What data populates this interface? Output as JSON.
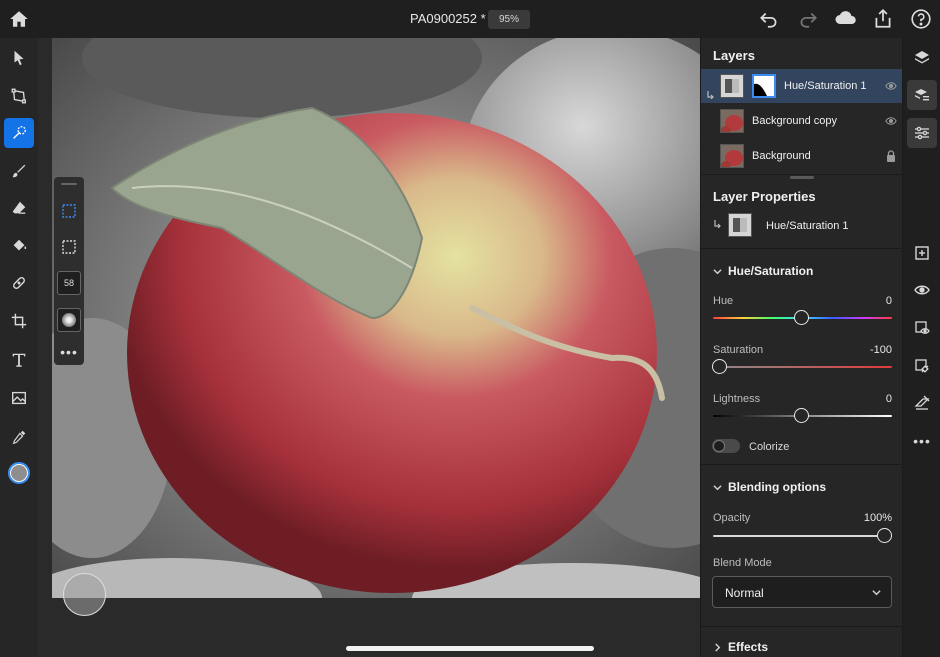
{
  "document": {
    "title": "PA0900252 *",
    "zoom": "95%"
  },
  "layers_panel": {
    "title": "Layers",
    "layers": [
      {
        "name": "Hue/Saturation 1",
        "selected": true,
        "status_icon": "eye-icon"
      },
      {
        "name": "Background copy",
        "selected": false,
        "status_icon": "eye-icon"
      },
      {
        "name": "Background",
        "selected": false,
        "status_icon": "lock-icon"
      }
    ]
  },
  "layer_properties": {
    "title": "Layer Properties",
    "layer_name": "Hue/Saturation 1",
    "hue_saturation": {
      "title": "Hue/Saturation",
      "hue": {
        "label": "Hue",
        "value": "0",
        "position": 0.5
      },
      "saturation": {
        "label": "Saturation",
        "value": "-100",
        "position": 0.0
      },
      "lightness": {
        "label": "Lightness",
        "value": "0",
        "position": 0.5
      },
      "colorize_label": "Colorize",
      "colorize_on": false
    },
    "blending": {
      "title": "Blending options",
      "opacity": {
        "label": "Opacity",
        "value": "100%",
        "position": 1.0
      },
      "blend_mode_label": "Blend Mode",
      "blend_mode": "Normal"
    },
    "effects_title": "Effects"
  },
  "subtools": {
    "brush_size": "58"
  },
  "colors": {
    "accent": "#1473e6",
    "foreground_swatch": "#8e8e8e",
    "background_swatch": "#ffffff"
  }
}
